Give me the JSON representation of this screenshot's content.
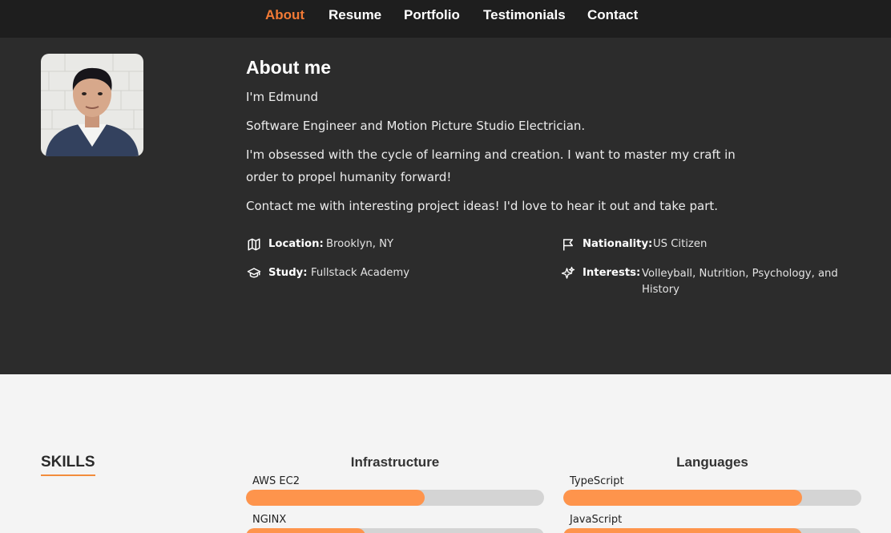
{
  "nav": {
    "items": [
      {
        "label": "About",
        "active": true
      },
      {
        "label": "Resume"
      },
      {
        "label": "Portfolio"
      },
      {
        "label": "Testimonials"
      },
      {
        "label": "Contact"
      }
    ]
  },
  "about": {
    "title": "About me",
    "paragraphs": [
      "I'm Edmund",
      "Software Engineer and Motion Picture Studio Electrician.",
      "I'm obsessed with the cycle of learning and creation. I want to master my craft in order to propel humanity forward!",
      "Contact me with interesting project ideas! I'd love to hear it out and take part."
    ],
    "info": {
      "location": {
        "label": "Location:",
        "value": "Brooklyn, NY",
        "icon": "map-icon"
      },
      "nationality": {
        "label": "Nationality:",
        "value": "US Citizen",
        "icon": "flag-icon"
      },
      "study": {
        "label": "Study:",
        "value": "Fullstack Academy",
        "icon": "graduation-cap-icon"
      },
      "interests": {
        "label": "Interests:",
        "value": "Volleyball, Nutrition, Psychology, and History",
        "icon": "sparkles-icon"
      }
    }
  },
  "skills": {
    "title": "SKILLS",
    "categories": [
      {
        "name": "Infrastructure",
        "items": [
          {
            "name": "AWS EC2",
            "level": 0.6
          },
          {
            "name": "NGINX",
            "level": 0.4
          }
        ]
      },
      {
        "name": "Languages",
        "items": [
          {
            "name": "TypeScript",
            "level": 0.8
          },
          {
            "name": "JavaScript",
            "level": 0.8
          }
        ]
      }
    ]
  },
  "colors": {
    "accent": "#f27a35",
    "bar_fill": "#fe944c",
    "bar_track": "#d4d4d4",
    "dark_bg": "#2c2c2c",
    "nav_bg": "#1e1e1e",
    "light_bg": "#f4f4f4"
  }
}
